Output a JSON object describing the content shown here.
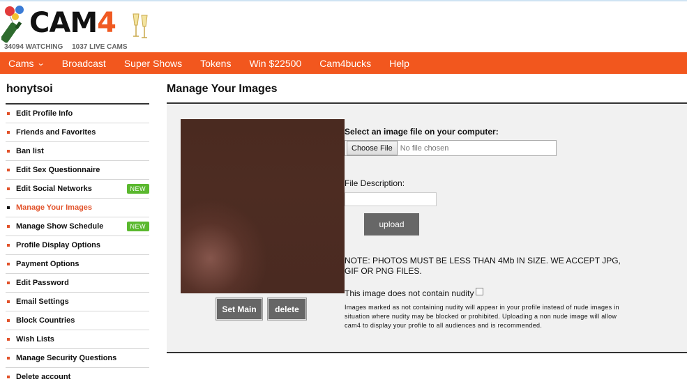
{
  "header": {
    "logo_text": "CAM4",
    "watching": "34094 WATCHING",
    "live_cams": "1037 LIVE CAMS"
  },
  "nav": {
    "items": [
      "Cams",
      "Broadcast",
      "Super Shows",
      "Tokens",
      "Win $22500",
      "Cam4bucks",
      "Help"
    ],
    "cams_icon": "chevron-down-icon"
  },
  "sidebar": {
    "username": "honytsoi",
    "items": [
      {
        "label": "Edit Profile Info"
      },
      {
        "label": "Friends and Favorites"
      },
      {
        "label": "Ban list"
      },
      {
        "label": "Edit Sex Questionnaire"
      },
      {
        "label": "Edit Social Networks",
        "badge": "NEW"
      },
      {
        "label": "Manage Your Images",
        "active": true
      },
      {
        "label": "Manage Show Schedule",
        "badge": "NEW"
      },
      {
        "label": "Profile Display Options"
      },
      {
        "label": "Payment Options"
      },
      {
        "label": "Edit Password"
      },
      {
        "label": "Email Settings"
      },
      {
        "label": "Block Countries"
      },
      {
        "label": "Wish Lists"
      },
      {
        "label": "Manage Security Questions"
      },
      {
        "label": "Delete account"
      }
    ]
  },
  "main": {
    "title": "Manage Your Images",
    "set_main": "Set Main",
    "delete": "delete",
    "select_file_label": "Select an image file on your computer:",
    "choose_file": "Choose File",
    "no_file": "No file chosen",
    "file_description_label": "File Description:",
    "file_description_value": "",
    "upload": "upload",
    "note": "NOTE: PHOTOS MUST BE LESS THAN 4Mb IN SIZE. WE ACCEPT JPG, GIF OR PNG FILES.",
    "nudity_label": "This image does not contain nudity",
    "nudity_checked": false,
    "fine_print": "Images marked as not containing nudity will appear in your profile instead of nude images in situation where nudity may be blocked or prohibited. Uploading a non nude image will allow cam4 to display your profile to all audiences and is recommended."
  },
  "colors": {
    "brand_orange": "#f2571e",
    "active_link": "#e2522a",
    "badge_green": "#5ab82e"
  }
}
